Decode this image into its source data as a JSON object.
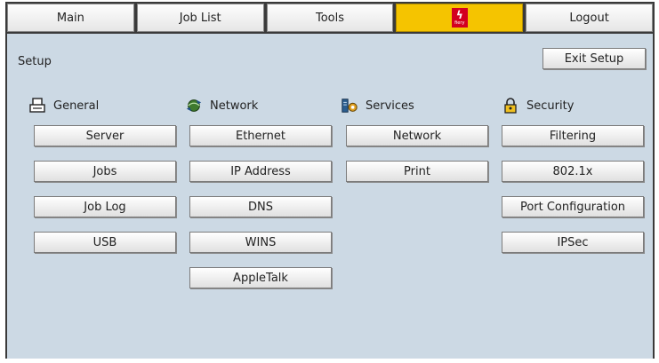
{
  "tabs": {
    "main": "Main",
    "job_list": "Job List",
    "tools": "Tools",
    "fiery_text": "fiery",
    "logout": "Logout"
  },
  "setup": {
    "title": "Setup",
    "exit_label": "Exit Setup"
  },
  "sections": {
    "general": {
      "title": "General",
      "icon": "printer-icon",
      "buttons": [
        "Server",
        "Jobs",
        "Job Log",
        "USB"
      ]
    },
    "network": {
      "title": "Network",
      "icon": "network-icon",
      "buttons": [
        "Ethernet",
        "IP Address",
        "DNS",
        "WINS",
        "AppleTalk"
      ]
    },
    "services": {
      "title": "Services",
      "icon": "services-icon",
      "buttons": [
        "Network",
        "Print"
      ]
    },
    "security": {
      "title": "Security",
      "icon": "lock-icon",
      "buttons": [
        "Filtering",
        "802.1x",
        "Port Configuration",
        "IPSec"
      ]
    }
  },
  "colors": {
    "background": "#ccd9e4",
    "active_tab": "#f5c400",
    "fiery_red": "#d3001f"
  }
}
